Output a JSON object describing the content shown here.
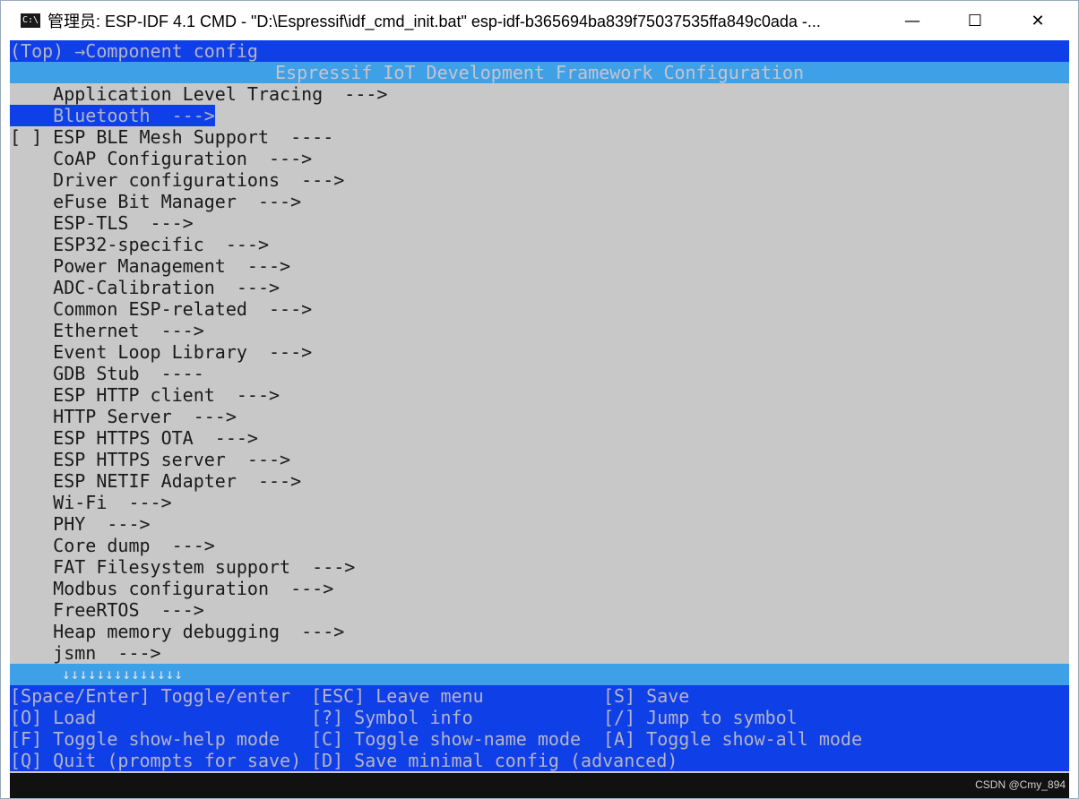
{
  "window": {
    "title": "管理员: ESP-IDF 4.1 CMD - \"D:\\Espressif\\idf_cmd_init.bat\"  esp-idf-b365694ba839f75037535ffa849c0ada -...",
    "min_glyph": "—",
    "max_glyph": "☐",
    "close_glyph": "✕"
  },
  "menuconfig": {
    "breadcrumb": "(Top) →Component config",
    "heading": "Espressif IoT Development Framework Configuration",
    "items": [
      {
        "prefix": "    ",
        "label": "Application Level Tracing  --->"
      },
      {
        "prefix": "    ",
        "label": "Bluetooth  --->"
      },
      {
        "prefix": "[ ] ",
        "label": "ESP BLE Mesh Support  ----"
      },
      {
        "prefix": "    ",
        "label": "CoAP Configuration  --->"
      },
      {
        "prefix": "    ",
        "label": "Driver configurations  --->"
      },
      {
        "prefix": "    ",
        "label": "eFuse Bit Manager  --->"
      },
      {
        "prefix": "    ",
        "label": "ESP-TLS  --->"
      },
      {
        "prefix": "    ",
        "label": "ESP32-specific  --->"
      },
      {
        "prefix": "    ",
        "label": "Power Management  --->"
      },
      {
        "prefix": "    ",
        "label": "ADC-Calibration  --->"
      },
      {
        "prefix": "    ",
        "label": "Common ESP-related  --->"
      },
      {
        "prefix": "    ",
        "label": "Ethernet  --->"
      },
      {
        "prefix": "    ",
        "label": "Event Loop Library  --->"
      },
      {
        "prefix": "    ",
        "label": "GDB Stub  ----"
      },
      {
        "prefix": "    ",
        "label": "ESP HTTP client  --->"
      },
      {
        "prefix": "    ",
        "label": "HTTP Server  --->"
      },
      {
        "prefix": "    ",
        "label": "ESP HTTPS OTA  --->"
      },
      {
        "prefix": "    ",
        "label": "ESP HTTPS server  --->"
      },
      {
        "prefix": "    ",
        "label": "ESP NETIF Adapter  --->"
      },
      {
        "prefix": "    ",
        "label": "Wi-Fi  --->"
      },
      {
        "prefix": "    ",
        "label": "PHY  --->"
      },
      {
        "prefix": "    ",
        "label": "Core dump  --->"
      },
      {
        "prefix": "    ",
        "label": "FAT Filesystem support  --->"
      },
      {
        "prefix": "    ",
        "label": "Modbus configuration  --->"
      },
      {
        "prefix": "    ",
        "label": "FreeRTOS  --->"
      },
      {
        "prefix": "    ",
        "label": "Heap memory debugging  --->"
      },
      {
        "prefix": "    ",
        "label": "jsmn  --->"
      }
    ],
    "more_indicator": "↓↓↓↓↓↓↓↓↓↓↓↓↓↓",
    "footer": [
      [
        "[Space/Enter] Toggle/enter",
        "[ESC] Leave menu",
        "[S] Save"
      ],
      [
        "[O] Load",
        "[?] Symbol info",
        "[/] Jump to symbol"
      ],
      [
        "[F] Toggle show-help mode",
        "[C] Toggle show-name mode",
        "[A] Toggle show-all mode"
      ],
      [
        "[Q] Quit (prompts for save)",
        "[D] Save minimal config (advanced)",
        ""
      ]
    ]
  },
  "watermark": "CSDN @Cmy_894",
  "colors": {
    "bar_blue": "#0f3fe6",
    "bar_light": "#3ea0e6",
    "terminal_bg": "#c8c8c8"
  }
}
